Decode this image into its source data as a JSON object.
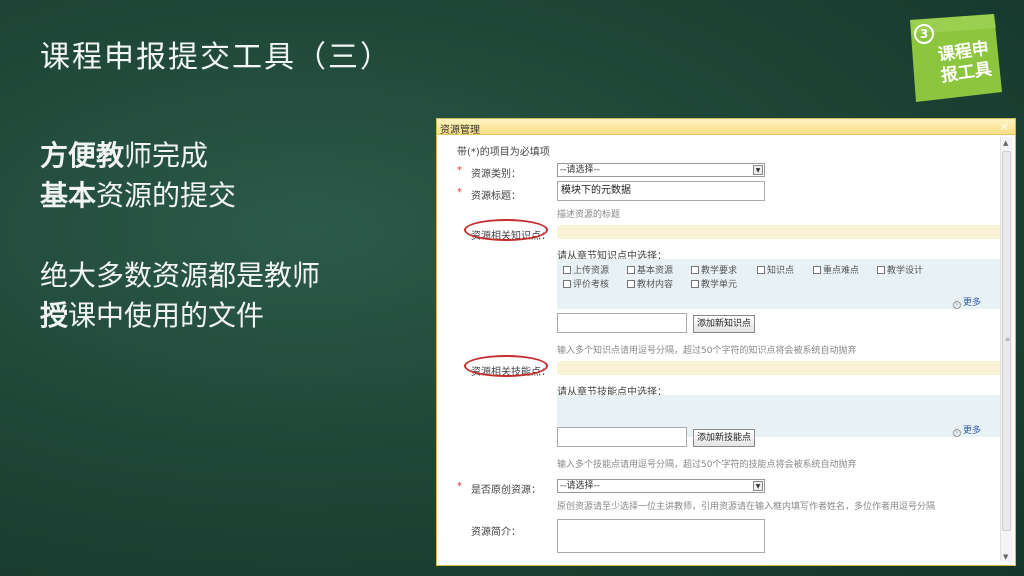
{
  "slide": {
    "title": "课程申报提交工具（三）",
    "line1_bold": "方便教",
    "line1_rest": "师完成",
    "line2_bold": "基本",
    "line2_rest": "资源的提交",
    "line3": "绝大多数资源都是教师",
    "line4_bold": "授",
    "line4_rest": "课中使用的文件"
  },
  "badge": {
    "number": "3",
    "line1": "课程申",
    "line2": "报工具"
  },
  "dialog": {
    "title": "资源管理",
    "close": "×",
    "required_note": "带(*)的项目为必填项",
    "asterisk": "*",
    "resource_type": {
      "label": "资源类别：",
      "value": "--请选择--"
    },
    "resource_title": {
      "label": "资源标题：",
      "value": "模块下的元数据",
      "hint": "描述资源的标题"
    },
    "knowledge": {
      "label": "资源相关知识点：",
      "prompt": "请从章节知识点中选择：",
      "options_row1": [
        "上传资源",
        "基本资源",
        "教学要求",
        "知识点",
        "重点难点",
        "教学设计"
      ],
      "options_row2": [
        "评价考核",
        "教材内容",
        "教学单元"
      ],
      "more": "更多",
      "add_button": "添加新知识点",
      "hint": "输入多个知识点请用逗号分隔，超过50个字符的知识点将会被系统自动抛弃"
    },
    "skill": {
      "label": "资源相关技能点：",
      "prompt": "请从章节技能点中选择：",
      "more": "更多",
      "add_button": "添加新技能点",
      "hint": "输入多个技能点请用逗号分隔，超过50个字符的技能点将会被系统自动抛弃"
    },
    "original": {
      "label": "是否原创资源：",
      "value": "--请选择--",
      "hint": "原创资源请至少选择一位主讲教师，引用资源请在输入框内填写作者姓名，多位作者用逗号分隔"
    },
    "summary": {
      "label": "资源简介："
    }
  },
  "colors": {
    "accent_badge": "#8cc63f",
    "highlight": "#c42c2c",
    "dialog_header": "#f8df86"
  }
}
